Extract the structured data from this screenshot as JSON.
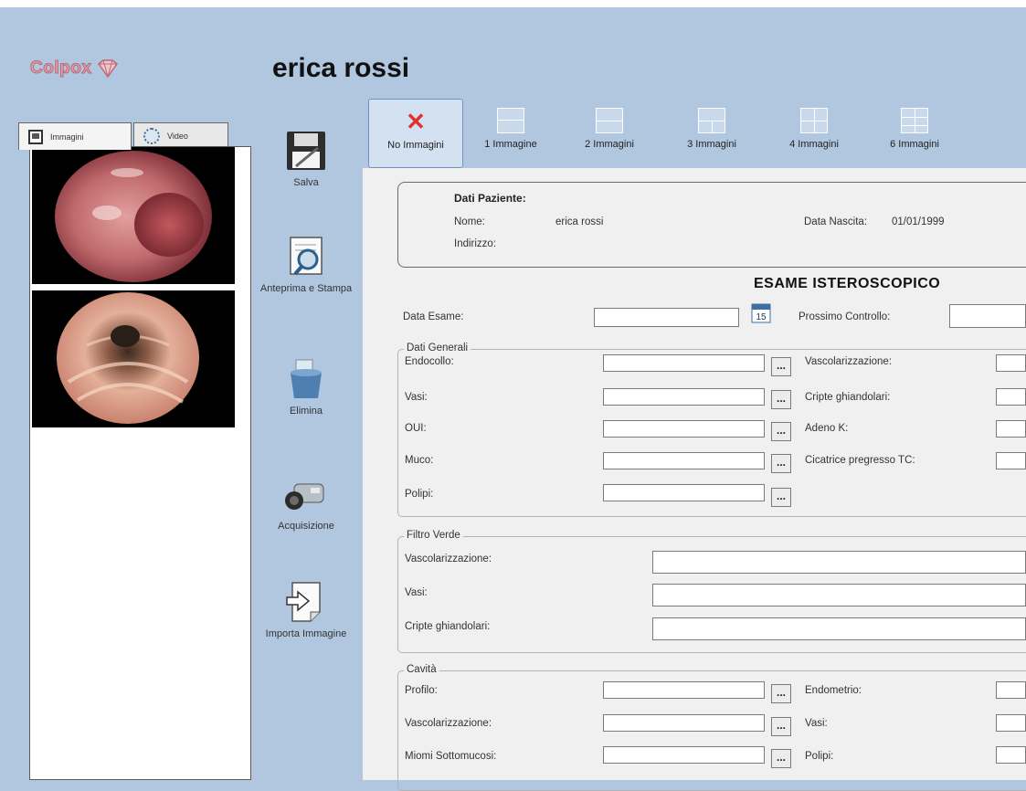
{
  "app": {
    "logo_text": "Colpox"
  },
  "patient_header": {
    "name": "erica rossi"
  },
  "left_tabs": [
    {
      "label": "Immagini",
      "icon": "image-icon",
      "active": true
    },
    {
      "label": "Video",
      "icon": "video-icon",
      "active": false
    }
  ],
  "thumbnails": [
    {
      "label": "thumbnail-1"
    },
    {
      "label": "thumbnail-2"
    }
  ],
  "side_toolbar": [
    {
      "label": "Salva",
      "icon": "floppy-disk-icon"
    },
    {
      "label": "Anteprima e Stampa",
      "icon": "print-preview-icon"
    },
    {
      "label": "Elimina",
      "icon": "trash-bin-icon"
    },
    {
      "label": "Acquisizione",
      "icon": "camera-icon"
    },
    {
      "label": "Importa Immagine",
      "icon": "import-image-icon"
    }
  ],
  "layout_toolbar": [
    {
      "label": "No Immagini",
      "icon": "close-icon",
      "selected": true
    },
    {
      "label": "1 Immagine",
      "icon": "layout-1-icon",
      "selected": false
    },
    {
      "label": "2 Immagini",
      "icon": "layout-2-icon",
      "selected": false
    },
    {
      "label": "3 Immagini",
      "icon": "layout-3-icon",
      "selected": false
    },
    {
      "label": "4 Immagini",
      "icon": "layout-4-icon",
      "selected": false
    },
    {
      "label": "6 Immagini",
      "icon": "layout-6-icon",
      "selected": false
    }
  ],
  "patient_box": {
    "title": "Dati Paziente:",
    "name_label": "Nome:",
    "name_value": "erica rossi",
    "birth_label": "Data Nascita:",
    "birth_value": "01/01/1999",
    "address_label": "Indirizzo:",
    "address_value": ""
  },
  "exam": {
    "title": "ESAME ISTEROSCOPICO",
    "date_label": "Data Esame:",
    "date_value": "",
    "calendar_day": "15",
    "next_check_label": "Prossimo Controllo:",
    "next_check_value": ""
  },
  "dati_generali": {
    "legend": "Dati Generali",
    "left_fields": [
      "Endocollo:",
      "Vasi:",
      "OUI:",
      "Muco:",
      "Polipi:"
    ],
    "right_fields": [
      "Vascolarizzazione:",
      "Cripte ghiandolari:",
      "Adeno K:",
      "Cicatrice pregresso TC:"
    ]
  },
  "filtro_verde": {
    "legend": "Filtro Verde",
    "fields": [
      "Vascolarizzazione:",
      "Vasi:",
      "Cripte ghiandolari:"
    ]
  },
  "cavita": {
    "legend": "Cavità",
    "left_fields": [
      "Profilo:",
      "Vascolarizzazione:",
      "Miomi Sottomucosi:"
    ],
    "right_fields": [
      "Endometrio:",
      "Vasi:",
      "Polipi:"
    ]
  },
  "button_dots": "...",
  "colors": {
    "background": "#b1c6df",
    "form": "#f0f0f0",
    "accent_red": "#e03030"
  }
}
